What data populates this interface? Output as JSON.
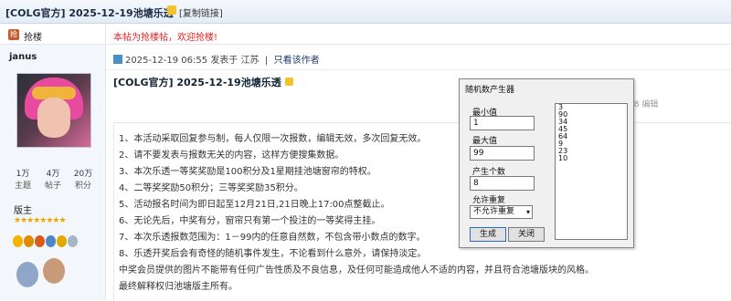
{
  "title_bar": {
    "title": "[COLG官方] 2025-12-19池塘乐透",
    "copy_link": "[复制链接]"
  },
  "quote": {
    "badge": "抢",
    "label": "抢楼"
  },
  "notice": "本帖为抢楼帖，欢迎抢楼!",
  "user": {
    "name": "janus",
    "stats": [
      {
        "value": "1万",
        "label": "主题"
      },
      {
        "value": "4万",
        "label": "帖子"
      },
      {
        "value": "20万",
        "label": "积分"
      }
    ],
    "role": "版主",
    "stars": "★★★★★★★★",
    "medal_colors": [
      "#f6b400",
      "#e08a00",
      "#d95a1a",
      "#4f86c6",
      "#e3a800",
      "#a8b5c4"
    ]
  },
  "post": {
    "date": "2025-12-19 06:55",
    "location": "发表于 江苏",
    "only_author": "只看该作者",
    "title": "[COLG官方] 2025-12-19池塘乐透",
    "edited": "08 编辑",
    "lines": [
      "1、本活动采取回复参与制，每人仅限一次报数，编辑无效，多次回复无效。",
      "2、请不要发表与报数无关的内容，这样方便搜集数据。",
      "3、本次乐透一等奖奖励是100积分及1星期挂池塘窗帘的特权。",
      "4、二等奖奖励50积分；三等奖奖励35积分。",
      "5、活动报名时间为即日起至12月21日,21日晚上17:00点整截止。",
      "6、无论先后，中奖有分，窗帘只有第一个投注的一等奖得主挂。",
      "7、本次乐透报数范围为：1－99内的任意自然数，不包含带小数点的数字。",
      "8、乐透开奖后会有奇怪的随机事件发生，不论看到什么意外，请保持淡定。",
      "中奖会员提供的图片不能带有任何广告性质及不良信息，及任何可能造成他人不适的内容，并且符合池塘版块的风格。",
      "最终解释权归池塘版主所有。"
    ]
  },
  "dialog": {
    "title": "随机数产生器",
    "min_label": "最小值",
    "min_value": "1",
    "max_label": "最大值",
    "max_value": "99",
    "count_label": "产生个数",
    "count_value": "8",
    "repeat_label": "允许重复",
    "repeat_value": "不允许重复",
    "generate_label": "生成",
    "close_label": "关闭",
    "results": [
      "3",
      "90",
      "34",
      "45",
      "64",
      "9",
      "23",
      "10"
    ]
  }
}
